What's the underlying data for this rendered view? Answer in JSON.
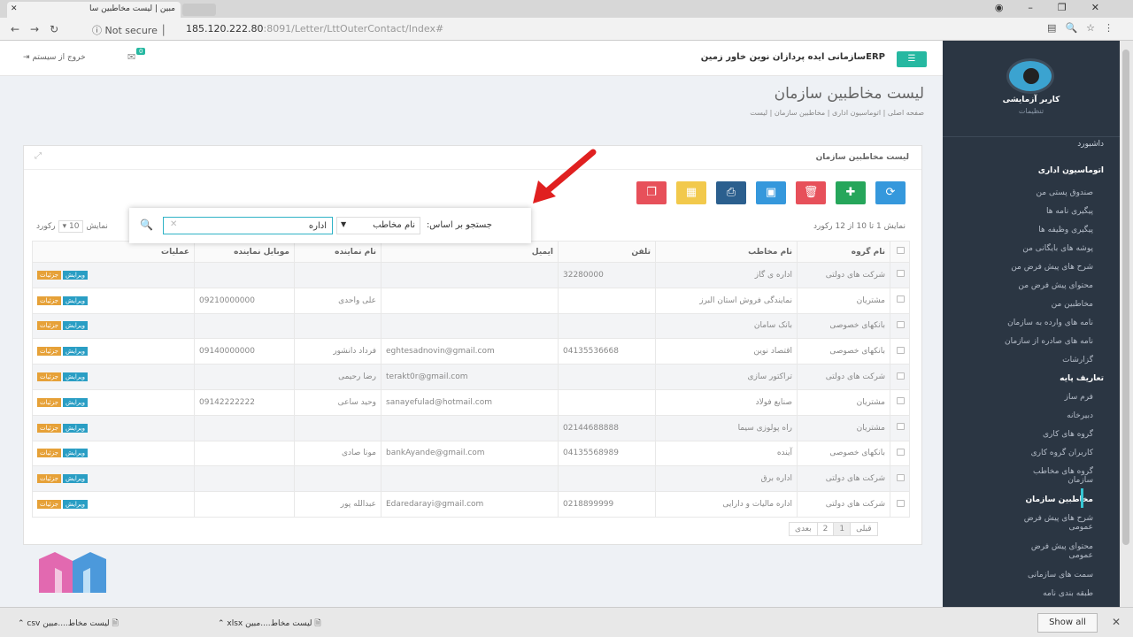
{
  "browser": {
    "tab_title": "مبین | لیست مخاطبین سا",
    "not_secure": "Not secure",
    "url_host": "185.120.222.80",
    "url_rest": ":8091/Letter/LttOuterContact/Index#"
  },
  "header": {
    "logo": "ERPسازمانی ایده پردازان نوین خاور زمین",
    "logout": "خروج از سیستم",
    "notif_count": "0"
  },
  "sidebar": {
    "user": "کاربر آزمایشی",
    "role": "تنظیمات",
    "items": [
      "داشبورد",
      "اتوماسیون اداری",
      "صندوق پستی من",
      "پیگیری نامه ها",
      "پیگیری وظیفه ها",
      "پوشه های بایگانی من",
      "شرح های پیش فرض من",
      "محتوای پیش فرض من",
      "مخاطبین من",
      "نامه های وارده به سازمان",
      "نامه های صادره از سازمان",
      "گزارشات",
      "تعاریف پایه",
      "فرم ساز",
      "دبیرخانه",
      "گروه های کاری",
      "کاربران گروه کاری",
      "گروه های مخاطب سازمان",
      "مخاطبین سازمان",
      "شرح های پیش فرض عمومی",
      "محتوای پیش فرض عمومی",
      "سمت های سازمانی",
      "طبقه بندی نامه"
    ]
  },
  "page": {
    "title": "لیست مخاطبین سازمان",
    "breadcrumb": "صفحه اصلی  |  اتوماسیون اداری  |  مخاطبین سازمان  |  لیست",
    "portlet_title": "لیست مخاطبین سازمان",
    "info": "نمایش 1 تا 10 از 12 رکورد",
    "length_label": "نمایش",
    "length_value": "10",
    "length_suffix": "رکورد"
  },
  "toolbar": {
    "colors": {
      "refresh": "#3598dc",
      "add": "#26a65b",
      "delete": "#e7505a",
      "excel": "#3598dc",
      "print": "#2b5f8e",
      "columns": "#f2c94c",
      "copy": "#e7505a"
    }
  },
  "search": {
    "label": "جستجو بر اساس:",
    "field": "نام مخاطب",
    "value": "اداره"
  },
  "table": {
    "headers": [
      "نام گروه",
      "نام مخاطب",
      "تلفن",
      "ایمیل",
      "نام نماینده",
      "موبایل نماینده",
      "عملیات"
    ],
    "edit_label": "ویرایش",
    "detail_label": "جزئیات",
    "rows": [
      [
        "شرکت های دولتی",
        "اداره ی گاز",
        "32280000",
        "",
        "",
        ""
      ],
      [
        "مشتریان",
        "نمایندگی فروش استان البرز",
        "",
        "",
        "علی واحدی",
        "09210000000"
      ],
      [
        "بانکهای خصوصی",
        "بانک سامان",
        "",
        "",
        "",
        ""
      ],
      [
        "بانکهای خصوصی",
        "اقتصاد نوین",
        "04135536668",
        "eghtesadnovin@gmail.com",
        "فرداد دانشور",
        "09140000000"
      ],
      [
        "شرکت های دولتی",
        "تراکتور سازی",
        "",
        "terakt0r@gmail.com",
        "رضا رحیمی",
        ""
      ],
      [
        "مشتریان",
        "صنایع فولاد",
        "",
        "sanayefulad@hotmail.com",
        "وحید ساعی",
        "09142222222"
      ],
      [
        "مشتریان",
        "راه پولوزی سیما",
        "02144688888",
        "",
        "",
        ""
      ],
      [
        "بانکهای خصوصی",
        "آینده",
        "04135568989",
        "bankAyande@gmail.com",
        "مونا صادی",
        ""
      ],
      [
        "شرکت های دولتی",
        "اداره برق",
        "",
        "",
        "",
        ""
      ],
      [
        "شرکت های دولتی",
        "اداره مالیات و دارایی",
        "0218899999",
        "Edaredarayi@gmail.com",
        "عبدالله پور",
        ""
      ]
    ]
  },
  "pager": {
    "prev": "قبلی",
    "pages": [
      "1",
      "2"
    ],
    "next": "بعدی"
  },
  "downloads": {
    "items": [
      "لیست مخاط....مبین xlsx",
      "لیست مخاط....مبین csv"
    ],
    "show_all": "Show all"
  }
}
